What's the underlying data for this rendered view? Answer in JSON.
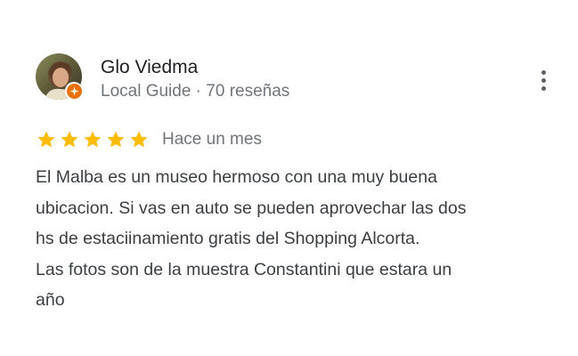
{
  "review": {
    "reviewer": {
      "name": "Glo Viedma",
      "meta": "Local Guide · 70 reseñas",
      "avatar_icon": "avatar-photo",
      "badge_icon": "local-guide-badge-icon",
      "badge_color": "#e8710a"
    },
    "menu_icon": "more-vert-icon",
    "rating": {
      "stars": 5,
      "max_stars": 5,
      "star_color": "#fbbc04",
      "date": "Hace un mes"
    },
    "text_lines": [
      "El Malba es un museo hermoso con una muy buena",
      "ubicacion. Si vas en auto se pueden aprovechar las dos",
      "hs de estaciinamiento gratis del Shopping Alcorta.",
      "Las fotos son de la muestra Constantini que estara un",
      "año"
    ]
  }
}
